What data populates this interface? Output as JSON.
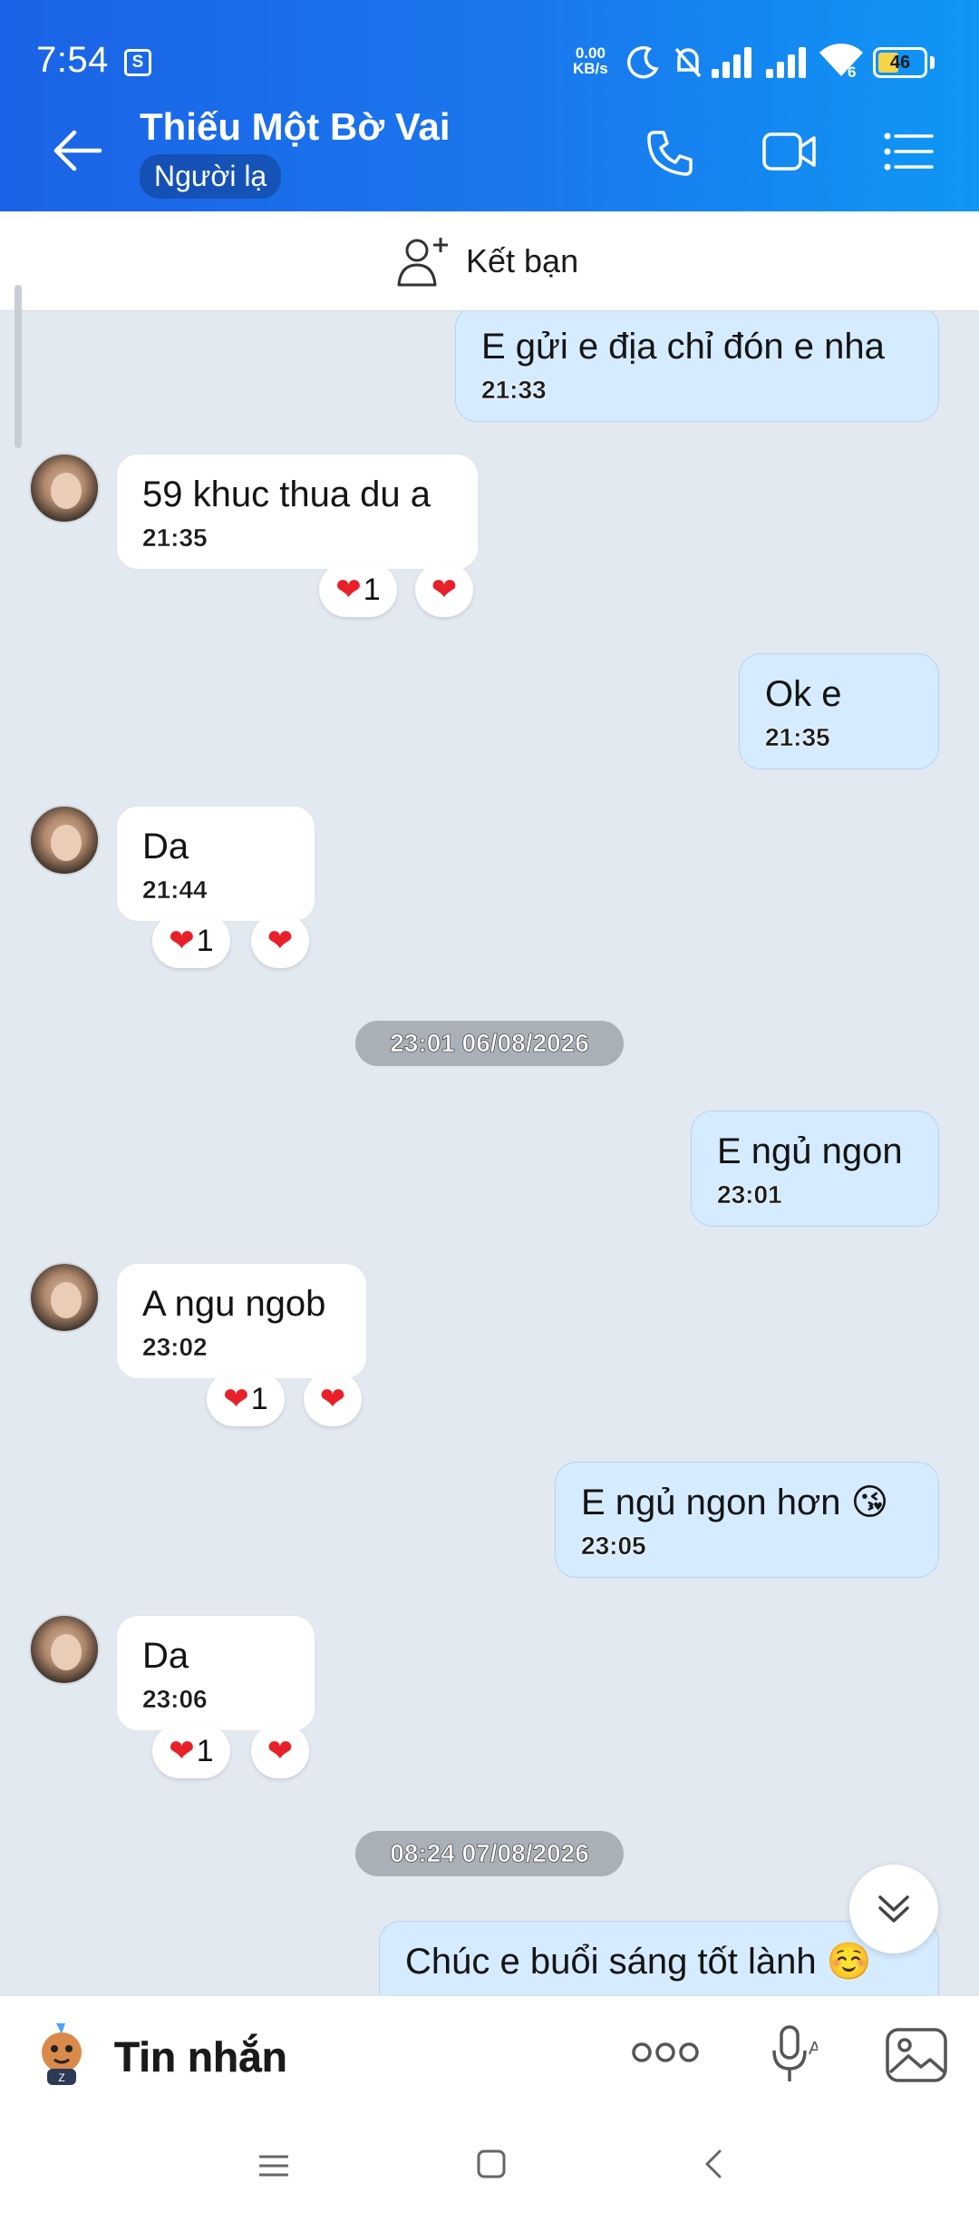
{
  "status_bar": {
    "time": "7:54",
    "speed_value": "0.00",
    "speed_unit": "KB/s",
    "wifi_generation": "6",
    "battery": "46",
    "battery_level_percent": 46
  },
  "header": {
    "title": "Thiếu Một Bờ Vai",
    "subtitle": "Người lạ"
  },
  "friend_bar": {
    "label": "Kết bạn"
  },
  "messages": [
    {
      "text": "E gửi e địa chỉ đón e nha",
      "time": "21:33"
    },
    {
      "text": "59 khuc thua du a",
      "time": "21:35",
      "reaction_count": "1"
    },
    {
      "text": "Ok e",
      "time": "21:35"
    },
    {
      "text": "Da",
      "time": "21:44",
      "reaction_count": "1"
    },
    {
      "date": "23:01 06/08/2026"
    },
    {
      "text": "E ngủ ngon",
      "time": "23:01"
    },
    {
      "text": "A ngu ngob",
      "time": "23:02",
      "reaction_count": "1"
    },
    {
      "text": "E ngủ ngon hơn 😘",
      "time": "23:05"
    },
    {
      "text": "Da",
      "time": "23:06",
      "reaction_count": "1"
    },
    {
      "date": "08:24 07/08/2026"
    },
    {
      "text": "Chúc e buổi sáng tốt lành ☺️"
    }
  ],
  "composer": {
    "placeholder": "Tin nhắn"
  },
  "colors": {
    "header_gradient_start": "#1b63e6",
    "header_gradient_end": "#0f97f5",
    "outgoing_bubble": "#d5ebff",
    "incoming_bubble": "#ffffff",
    "chat_background": "#e2e9f1",
    "heart": "#e8202a"
  },
  "icons": [
    "back-arrow-icon",
    "phone-icon",
    "video-icon",
    "list-menu-icon",
    "add-friend-icon",
    "heart-icon",
    "double-chevron-down-icon",
    "more-icon",
    "mic-icon",
    "image-icon",
    "mascot-icon"
  ]
}
